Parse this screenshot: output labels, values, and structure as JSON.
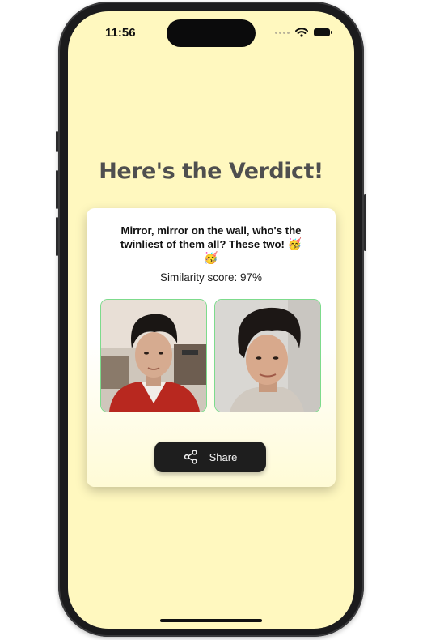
{
  "status_bar": {
    "time": "11:56"
  },
  "page": {
    "title": "Here's the Verdict!"
  },
  "result_card": {
    "message_text": "Mirror, mirror on the wall, who's the twinliest of them all? These two!",
    "emojis": "🥳 🥳",
    "similarity_label": "Similarity score: 97%",
    "share_label": "Share"
  },
  "icons": [
    "wifi-icon",
    "battery-icon",
    "share-icon"
  ],
  "colors": {
    "screen_background": "#fff8bf",
    "title_text": "#4f4f4f",
    "photo_border": "#7ddb8c",
    "share_button": "#1e1e1e"
  }
}
